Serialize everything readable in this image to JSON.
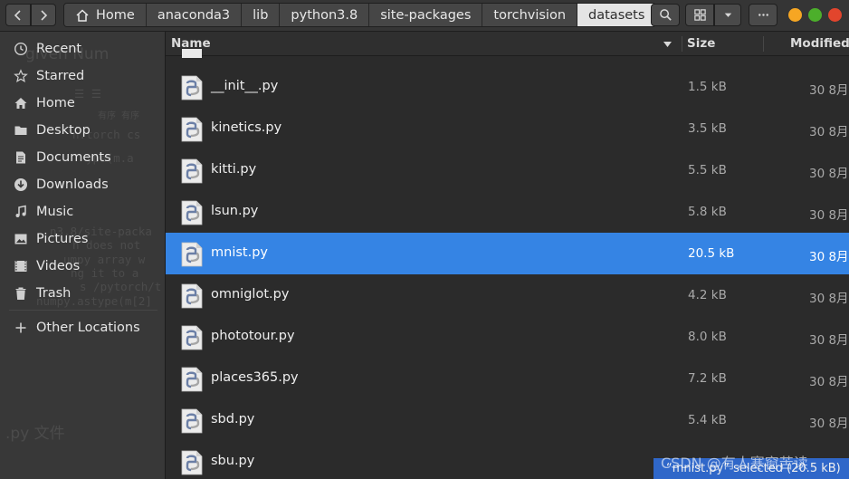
{
  "header": {
    "breadcrumbs": [
      "Home",
      "anaconda3",
      "lib",
      "python3.8",
      "site-packages",
      "torchvision",
      "datasets"
    ]
  },
  "sidebar": {
    "items": [
      {
        "label": "Recent",
        "icon": "clock-icon"
      },
      {
        "label": "Starred",
        "icon": "star-icon"
      },
      {
        "label": "Home",
        "icon": "home-icon"
      },
      {
        "label": "Desktop",
        "icon": "folder-icon"
      },
      {
        "label": "Documents",
        "icon": "document-icon"
      },
      {
        "label": "Downloads",
        "icon": "download-icon"
      },
      {
        "label": "Music",
        "icon": "music-icon"
      },
      {
        "label": "Pictures",
        "icon": "picture-icon"
      },
      {
        "label": "Videos",
        "icon": "video-icon"
      },
      {
        "label": "Trash",
        "icon": "trash-icon"
      }
    ],
    "other_locations": "Other Locations",
    "background_text": [
      "given Num",
      "☰      ☰",
      "有序   有序",
      "n.torch cs",
      "ype(m.a",
      "n3.8/site-packa",
      "h does not",
      "umpy array w",
      "ng it to a",
      "s /pytorch/t",
      "numpy.astype(m[2]",
      ".py 文件"
    ]
  },
  "columns": {
    "name": "Name",
    "size": "Size",
    "modified": "Modified"
  },
  "files": [
    {
      "name": "__init__.py",
      "size": "1.5 kB",
      "modified": "30 8月"
    },
    {
      "name": "kinetics.py",
      "size": "3.5 kB",
      "modified": "30 8月"
    },
    {
      "name": "kitti.py",
      "size": "5.5 kB",
      "modified": "30 8月"
    },
    {
      "name": "lsun.py",
      "size": "5.8 kB",
      "modified": "30 8月"
    },
    {
      "name": "mnist.py",
      "size": "20.5 kB",
      "modified": "30 8月",
      "selected": true
    },
    {
      "name": "omniglot.py",
      "size": "4.2 kB",
      "modified": "30 8月"
    },
    {
      "name": "phototour.py",
      "size": "8.0 kB",
      "modified": "30 8月"
    },
    {
      "name": "places365.py",
      "size": "7.2 kB",
      "modified": "30 8月"
    },
    {
      "name": "sbd.py",
      "size": "5.4 kB",
      "modified": "30 8月"
    },
    {
      "name": "sbu.py",
      "size": "",
      "modified": ""
    }
  ],
  "status": {
    "text": "“mnist.py” selected  (20.5 kB)"
  },
  "watermark": "CSDN @有人寒窗苦读",
  "colors": {
    "accent": "#3584e4",
    "sidebar_bg": "#383838",
    "list_bg": "#2b2b2b"
  }
}
